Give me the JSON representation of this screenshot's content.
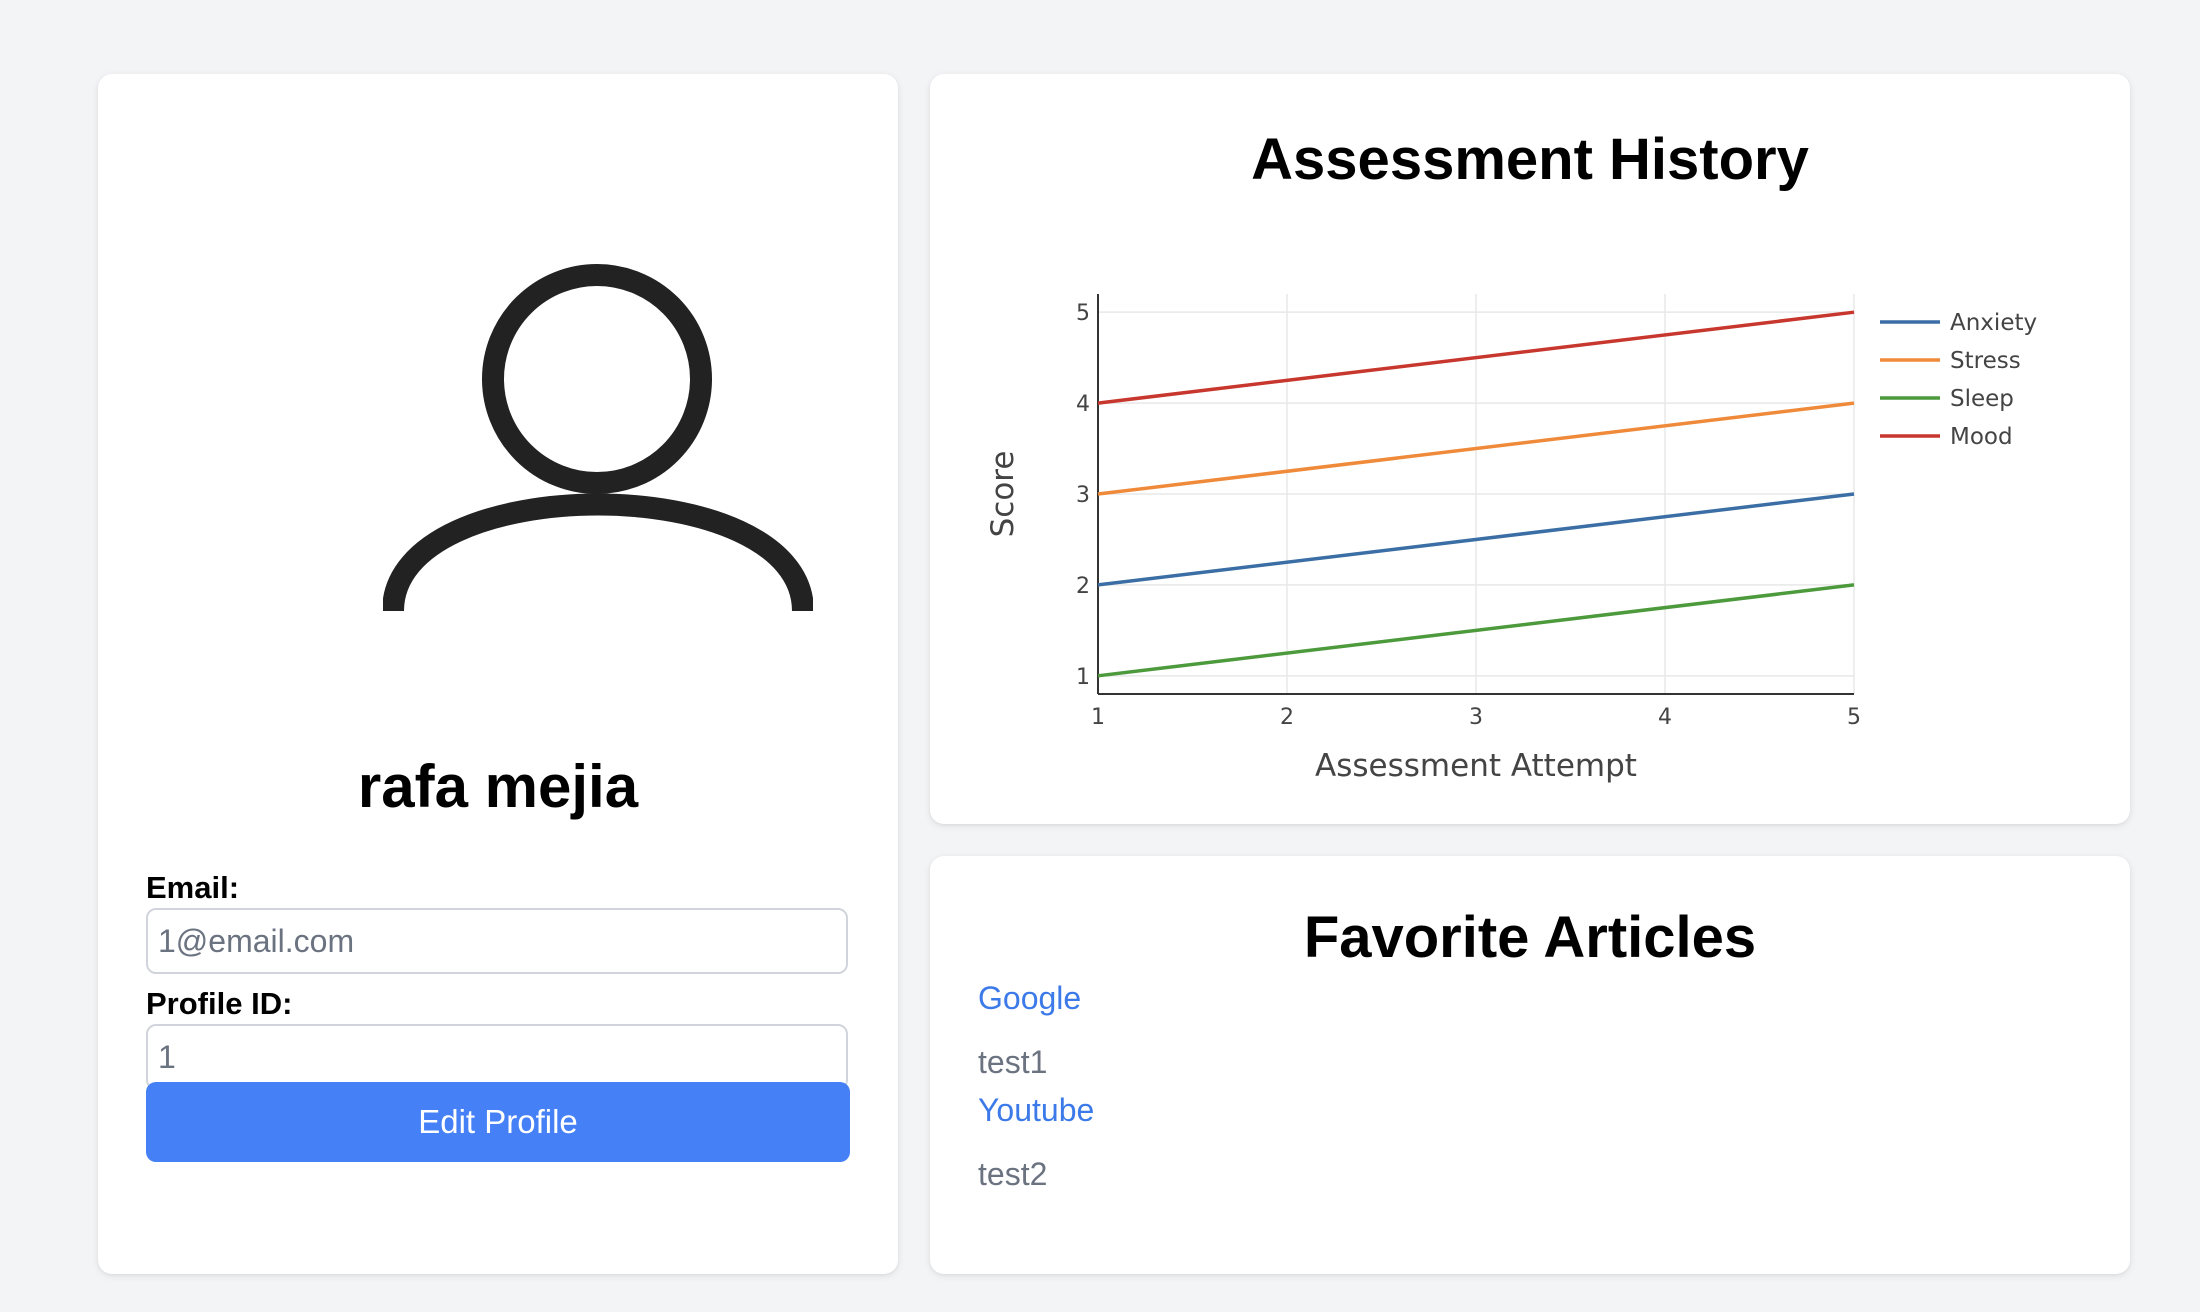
{
  "profile": {
    "name": "rafa mejia",
    "email_label": "Email:",
    "email_placeholder": "1@email.com",
    "profile_id_label": "Profile ID:",
    "profile_id_placeholder": "1",
    "edit_button": "Edit Profile",
    "avatar_icon": "user-icon"
  },
  "history": {
    "title": "Assessment History"
  },
  "chart_data": {
    "type": "line",
    "xlabel": "Assessment Attempt",
    "ylabel": "Score",
    "x": [
      1,
      5
    ],
    "xlim": [
      1,
      5
    ],
    "ylim": [
      0.8,
      5.2
    ],
    "xticks": [
      1,
      2,
      3,
      4,
      5
    ],
    "yticks": [
      1,
      2,
      3,
      4,
      5
    ],
    "grid": true,
    "legend_position": "top-right",
    "series": [
      {
        "name": "Anxiety",
        "color": "#3a6ea5",
        "values": [
          2,
          3
        ]
      },
      {
        "name": "Stress",
        "color": "#ef8a3a",
        "values": [
          3,
          4
        ]
      },
      {
        "name": "Sleep",
        "color": "#4c9a3c",
        "values": [
          1,
          2
        ]
      },
      {
        "name": "Mood",
        "color": "#c8372d",
        "values": [
          4,
          5
        ]
      }
    ]
  },
  "articles": {
    "title": "Favorite Articles",
    "items": [
      {
        "link": "Google",
        "description": "test1"
      },
      {
        "link": "Youtube",
        "description": "test2"
      }
    ]
  }
}
